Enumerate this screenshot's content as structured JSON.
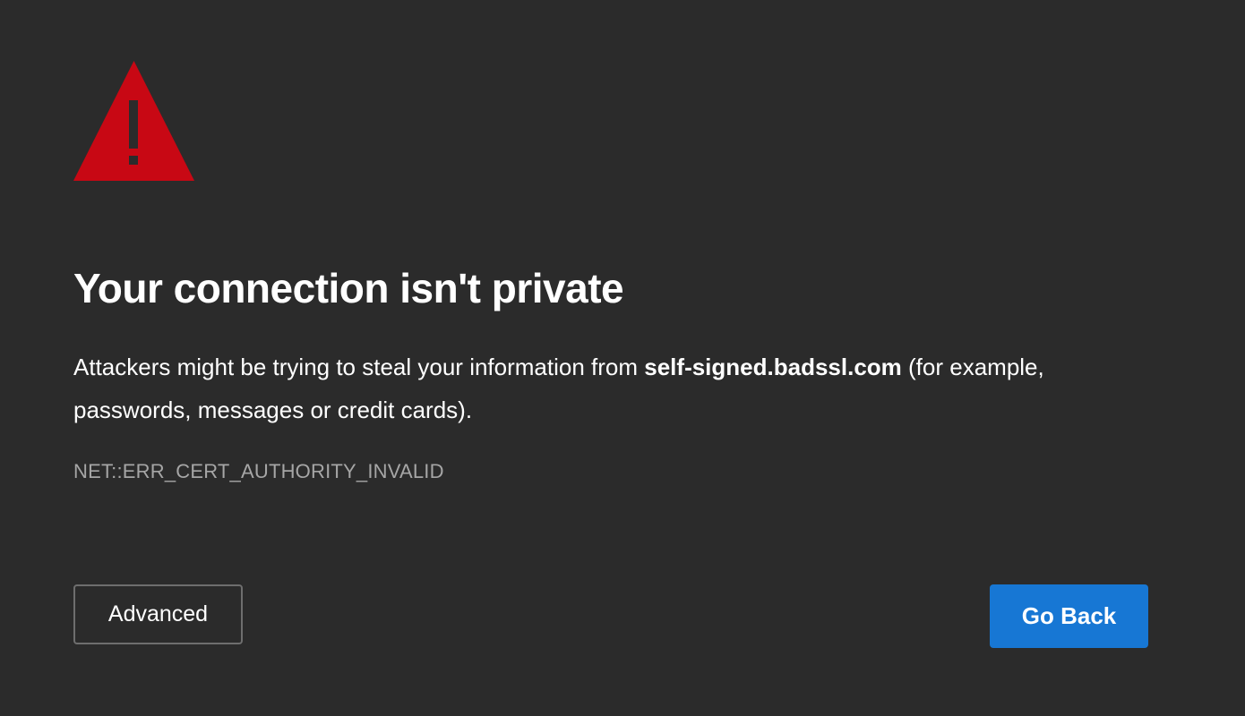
{
  "icon": {
    "name": "warning-triangle-icon",
    "color": "#c80814",
    "mark_color": "#2b2b2b"
  },
  "title": "Your connection isn't private",
  "description": {
    "prefix": "Attackers might be trying to steal your information from ",
    "domain": "self-signed.badssl.com",
    "suffix": " (for example, passwords, messages or credit cards)."
  },
  "error_code": "NET::ERR_CERT_AUTHORITY_INVALID",
  "buttons": {
    "advanced_label": "Advanced",
    "go_back_label": "Go Back"
  },
  "colors": {
    "background": "#2b2b2b",
    "primary_button": "#1777d4",
    "error_code_text": "#a6a6a6"
  }
}
